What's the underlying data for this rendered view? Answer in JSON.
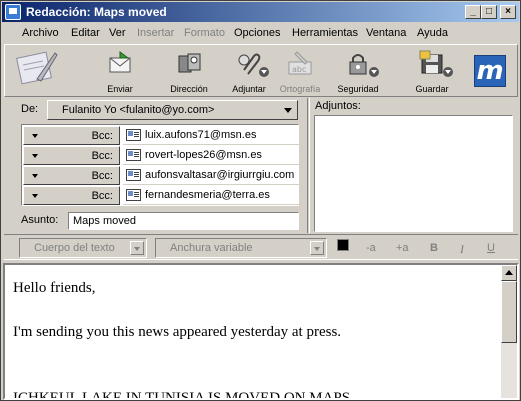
{
  "window": {
    "title": "Redacción: Maps moved",
    "controls": {
      "minimize": "_",
      "maximize": "□",
      "close": "×"
    }
  },
  "menubar": {
    "items": [
      {
        "label": "Archivo",
        "enabled": true
      },
      {
        "label": "Editar",
        "enabled": true
      },
      {
        "label": "Ver",
        "enabled": true
      },
      {
        "label": "Insertar",
        "enabled": false
      },
      {
        "label": "Formato",
        "enabled": false
      },
      {
        "label": "Opciones",
        "enabled": true
      },
      {
        "label": "Herramientas",
        "enabled": true
      },
      {
        "label": "Ventana",
        "enabled": true
      },
      {
        "label": "Ayuda",
        "enabled": true
      }
    ]
  },
  "toolbar": {
    "items": [
      {
        "label": "Enviar",
        "icon": "send-icon",
        "enabled": true
      },
      {
        "label": "Dirección",
        "icon": "address-icon",
        "enabled": true
      },
      {
        "label": "Adjuntar",
        "icon": "attach-icon",
        "enabled": true
      },
      {
        "label": "Ortografía",
        "icon": "spelling-icon",
        "enabled": false
      },
      {
        "label": "Seguridad",
        "icon": "security-icon",
        "enabled": true
      },
      {
        "label": "Guardar",
        "icon": "save-icon",
        "enabled": true
      }
    ]
  },
  "header": {
    "from_label": "De:",
    "from_value": "Fulanito Yo <fulanito@yo.com>",
    "recipients": [
      {
        "type": "Bcc:",
        "address": "luix.aufons71@msn.es"
      },
      {
        "type": "Bcc:",
        "address": "rovert-lopes26@msn.es"
      },
      {
        "type": "Bcc:",
        "address": "aufonsvaltasar@irgiurrgiu.com"
      },
      {
        "type": "Bcc:",
        "address": "fernandesmeria@terra.es"
      }
    ],
    "subject_label": "Asunto:",
    "subject_value": "Maps moved",
    "attachments_label": "Adjuntos:"
  },
  "format_bar": {
    "paragraph_style": "Cuerpo del texto",
    "font": "Anchura variable",
    "smaller": "-a",
    "larger": "+a",
    "bold": "B",
    "italic": "I",
    "underline": "U"
  },
  "body": {
    "lines": [
      "Hello friends,",
      "",
      "I'm sending you this news appeared yesterday at press.",
      "",
      "",
      "ICHKEUL LAKE IN TUNISIA IS MOVED ON MAPS"
    ]
  },
  "colors": {
    "titlebar_start": "#0a246a",
    "titlebar_end": "#a6caf0",
    "face": "#d4d0c8"
  }
}
